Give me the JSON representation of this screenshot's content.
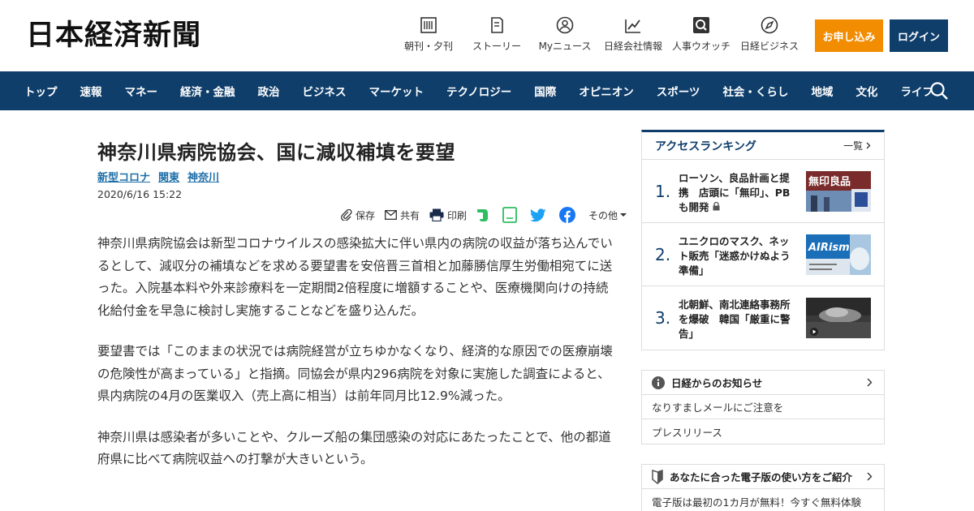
{
  "header": {
    "logo": "日本経済新聞",
    "nav": [
      {
        "label": "朝刊・夕刊",
        "icon": "newspaper-icon"
      },
      {
        "label": "ストーリー",
        "icon": "book-icon"
      },
      {
        "label": "Myニュース",
        "icon": "user-icon"
      },
      {
        "label": "日経会社情報",
        "icon": "chart-icon"
      },
      {
        "label": "人事ウオッチ",
        "icon": "magnifier-icon"
      },
      {
        "label": "日経ビジネス",
        "icon": "compass-icon"
      }
    ],
    "subscribe_label": "お申し込み",
    "login_label": "ログイン"
  },
  "main_nav": [
    "トップ",
    "速報",
    "マネー",
    "経済・金融",
    "政治",
    "ビジネス",
    "マーケット",
    "テクノロジー",
    "国際",
    "オピニオン",
    "スポーツ",
    "社会・くらし",
    "地域",
    "文化",
    "ライフ"
  ],
  "article": {
    "title": "神奈川県病院協会、国に減収補填を要望",
    "tags": [
      "新型コロナ",
      "関東",
      "神奈川"
    ],
    "date": "2020/6/16 15:22",
    "share": {
      "save": "保存",
      "share": "共有",
      "print": "印刷",
      "more": "その他"
    },
    "paragraphs": [
      "神奈川県病院協会は新型コロナウイルスの感染拡大に伴い県内の病院の収益が落ち込んでいるとして、減収分の補填などを求める要望書を安倍晋三首相と加藤勝信厚生労働相宛てに送った。入院基本料や外来診療料を一定期間2倍程度に増額することや、医療機関向けの持続化給付金を早急に検討し実施することなどを盛り込んだ。",
      "要望書では「このままの状況では病院経営が立ちゆかなくなり、経済的な原因での医療崩壊の危険性が高まっている」と指摘。同協会が県内296病院を対象に実施した調査によると、県内病院の4月の医業収入（売上高に相当）は前年同月比12.9%減った。",
      "神奈川県は感染者が多いことや、クルーズ船の集団感染の対応にあたったことで、他の都道府県に比べて病院収益への打撃が大きいという。"
    ]
  },
  "ranking": {
    "title": "アクセスランキング",
    "more": "一覧",
    "items": [
      {
        "num": "1.",
        "text": "ローソン、良品計画と提携　店頭に「無印」、PBも開発",
        "img_text": "無印良品"
      },
      {
        "num": "2.",
        "text": "ユニクロのマスク、ネット販売「迷惑かけぬよう準備」",
        "img_text": "AIRism"
      },
      {
        "num": "3.",
        "text": "北朝鮮、南北連絡事務所を爆破　韓国「厳重に警告」",
        "img_text": ""
      }
    ]
  },
  "notice": {
    "title": "日経からのお知らせ",
    "rows": [
      "なりすましメールにご注意を",
      "プレスリリース"
    ]
  },
  "guide": {
    "title": "あなたに合った電子版の使い方をご紹介",
    "row": "電子版は最初の1カ月が無料！今すぐ無料体験"
  }
}
